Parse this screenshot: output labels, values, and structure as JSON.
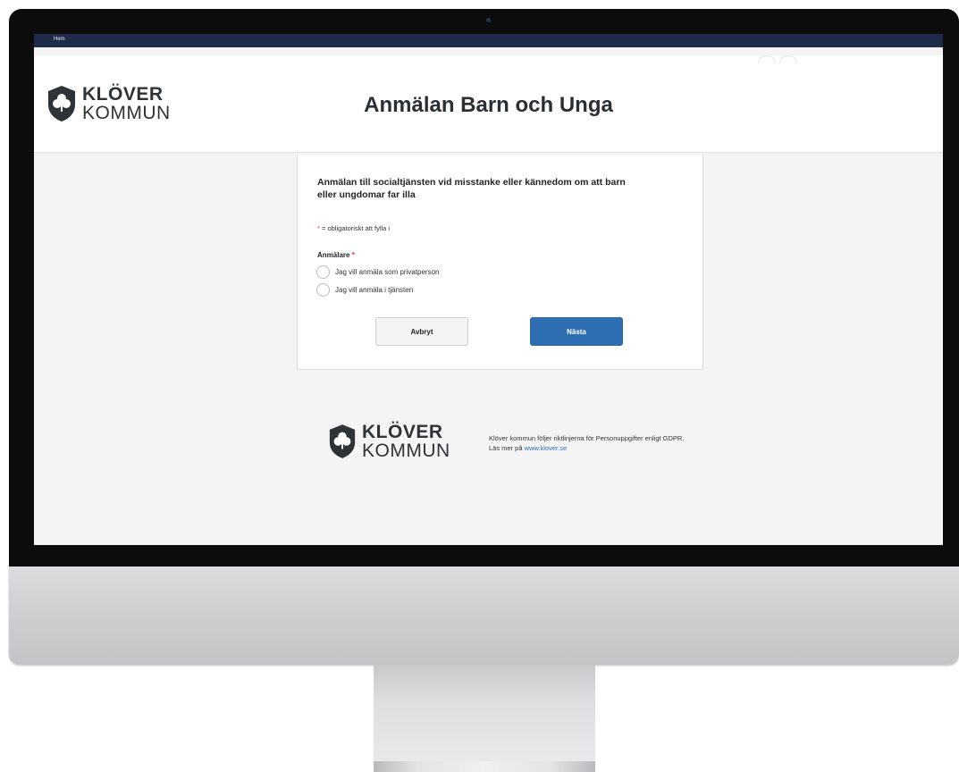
{
  "topbar": {
    "home_label": "Hem"
  },
  "header": {
    "logo_line1": "KLÖVER",
    "logo_line2": "KOMMUN",
    "title": "Anmälan Barn och Unga"
  },
  "form": {
    "heading": "Anmälan till socialtjänsten vid misstanke eller kännedom om att barn eller ungdomar far illa",
    "required_star": "*",
    "required_note": " = obligatoriskt att fylla i",
    "field_label": "Anmälare",
    "options": [
      {
        "label": "Jag vill anmäla som privatperson",
        "selected": false
      },
      {
        "label": "Jag vill anmäla i tjänsten",
        "selected": false
      }
    ],
    "cancel_label": "Avbryt",
    "next_label": "Nästa"
  },
  "footer": {
    "logo_line1": "KLÖVER",
    "logo_line2": "KOMMUN",
    "privacy_text": "Klöver kommun följer riktlinjerna för Personuppgifter enligt GDPR.",
    "more_prefix": "Läs mer på ",
    "link_text": "www.klover.se"
  },
  "colors": {
    "nav": "#1e2a4a",
    "primary_button": "#2e6fb4",
    "required": "#e0322f",
    "logo": "#2e3338"
  }
}
